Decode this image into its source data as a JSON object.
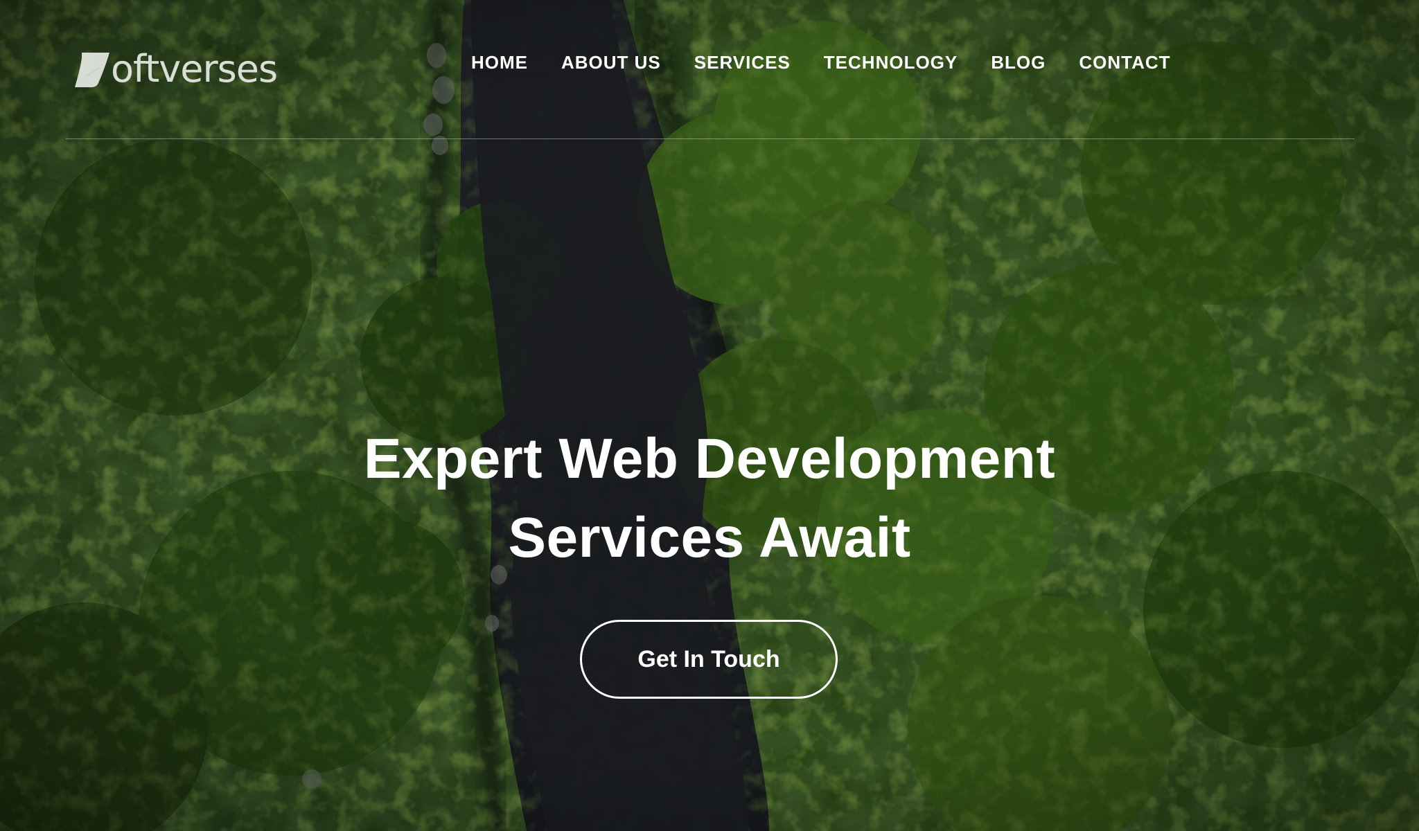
{
  "logo": {
    "text": "oftverses",
    "mark_icon": "s-leaf-logo-mark"
  },
  "nav": {
    "items": [
      {
        "label": "HOME"
      },
      {
        "label": "ABOUT US"
      },
      {
        "label": "SERVICES"
      },
      {
        "label": "TECHNOLOGY"
      },
      {
        "label": "BLOG"
      },
      {
        "label": "CONTACT"
      }
    ]
  },
  "hero": {
    "headline_line1": "Expert Web Development",
    "headline_line2": "Services Await",
    "cta_label": "Get In Touch",
    "background": "aerial-forest-river-photo"
  },
  "colors": {
    "text": "#ffffff",
    "forest_dark": "#16210f",
    "forest_green": "#2f5a14",
    "river": "#23262c"
  }
}
